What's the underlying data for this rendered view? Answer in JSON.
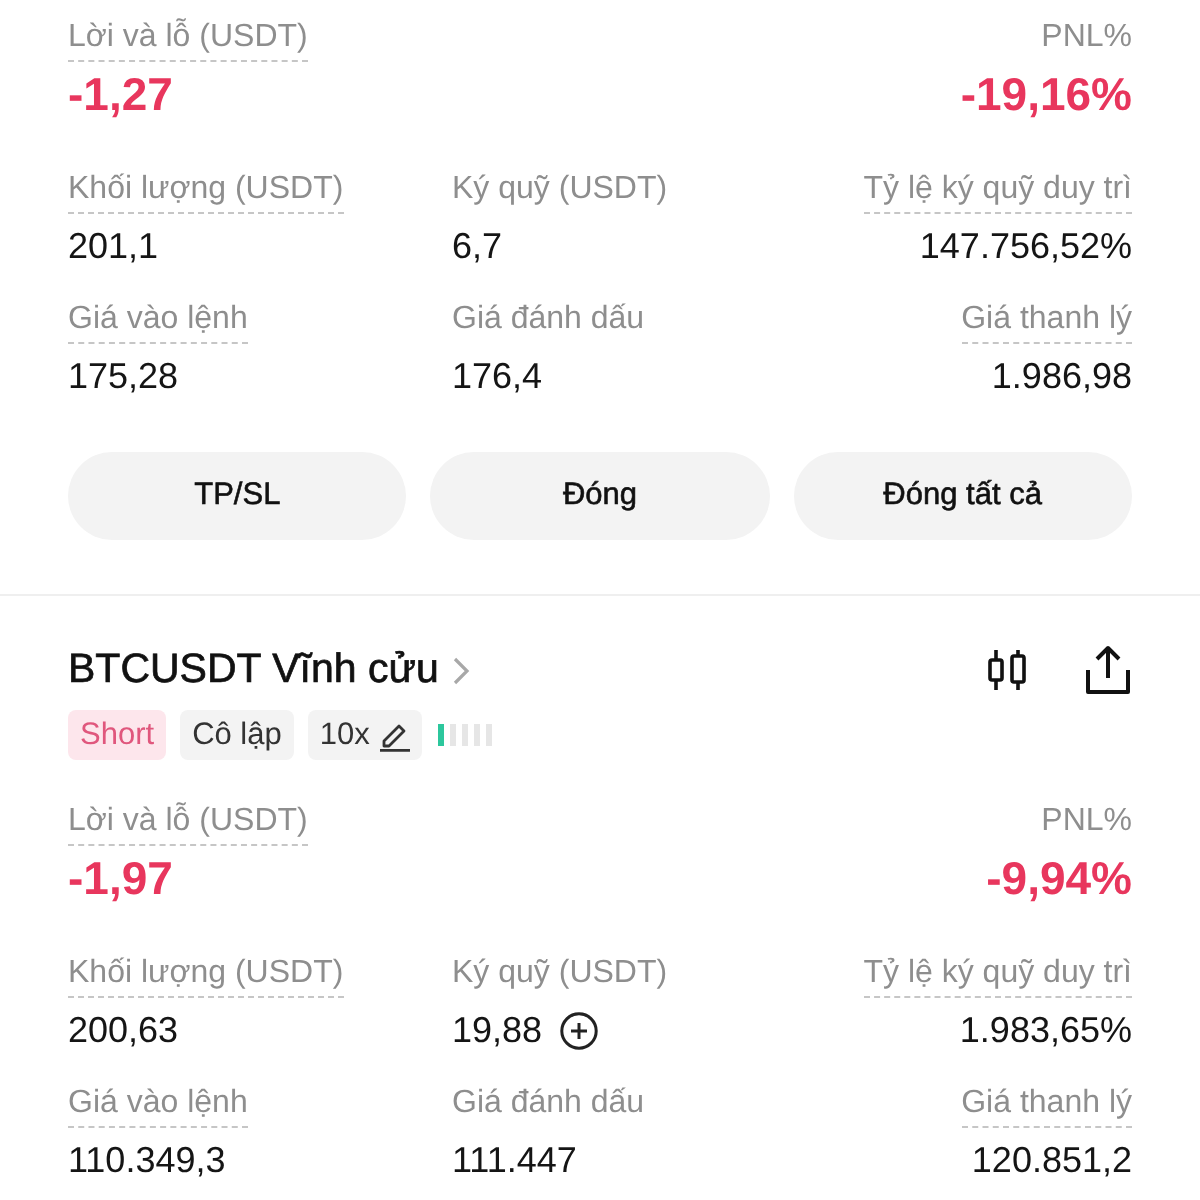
{
  "positions": [
    {
      "pnl": {
        "label": "Lời và lỗ (USDT)",
        "value": "-1,27",
        "loss": true,
        "underlined": true
      },
      "pnl_percent": {
        "label": "PNL%",
        "value": "-19,16%",
        "loss": true,
        "underlined": false
      },
      "stats": [
        {
          "label": "Khối lượng (USDT)",
          "value": "201,1",
          "underlined": true,
          "add_icon": false
        },
        {
          "label": "Ký quỹ (USDT)",
          "value": "6,7",
          "underlined": false,
          "add_icon": false
        },
        {
          "label": "Tỷ lệ ký quỹ duy trì",
          "value": "147.756,52%",
          "underlined": true,
          "add_icon": false
        },
        {
          "label": "Giá vào lệnh",
          "value": "175,28",
          "underlined": true,
          "add_icon": false
        },
        {
          "label": "Giá đánh dấu",
          "value": "176,4",
          "underlined": false,
          "add_icon": false
        },
        {
          "label": "Giá thanh lý",
          "value": "1.986,98",
          "underlined": true,
          "add_icon": false
        }
      ],
      "buttons": [
        "TP/SL",
        "Đóng",
        "Đóng tất cả"
      ]
    },
    {
      "title": "BTCUSDT Vĩnh cửu",
      "tags": [
        {
          "label": "Short",
          "kind": "side"
        },
        {
          "label": "Cô lập",
          "kind": "mode"
        },
        {
          "label": "10x",
          "kind": "leverage"
        }
      ],
      "risk_meter": {
        "level": 0.2
      },
      "pnl": {
        "label": "Lời và lỗ (USDT)",
        "value": "-1,97",
        "loss": true,
        "underlined": true
      },
      "pnl_percent": {
        "label": "PNL%",
        "value": "-9,94%",
        "loss": true,
        "underlined": false
      },
      "stats": [
        {
          "label": "Khối lượng (USDT)",
          "value": "200,63",
          "underlined": true,
          "add_icon": false
        },
        {
          "label": "Ký quỹ (USDT)",
          "value": "19,88",
          "underlined": false,
          "add_icon": true
        },
        {
          "label": "Tỷ lệ ký quỹ duy trì",
          "value": "1.983,65%",
          "underlined": true,
          "add_icon": false
        },
        {
          "label": "Giá vào lệnh",
          "value": "110.349,3",
          "underlined": true,
          "add_icon": false
        },
        {
          "label": "Giá đánh dấu",
          "value": "111.447",
          "underlined": false,
          "add_icon": false
        },
        {
          "label": "Giá thanh lý",
          "value": "120.851,2",
          "underlined": true,
          "add_icon": false
        }
      ]
    }
  ]
}
